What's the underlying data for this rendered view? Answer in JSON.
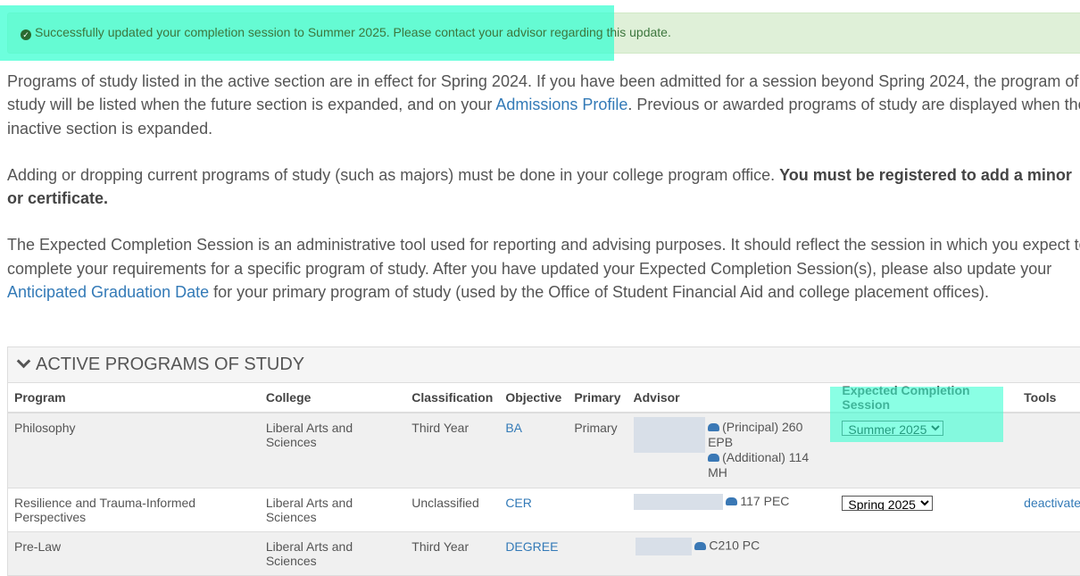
{
  "alert": {
    "icon": "check-circle-icon",
    "message": "Successfully updated your completion session to Summer 2025. Please contact your advisor regarding this update."
  },
  "intro": {
    "p1_a": "Programs of study listed in the active section are in effect for Spring 2024. If you have been admitted for a session beyond Spring 2024, the program of study will be listed when the future section is expanded, and on your ",
    "p1_link": "Admissions Profile",
    "p1_b": ". Previous or awarded programs of study are displayed when the inactive section is expanded.",
    "p2_a": "Adding or dropping current programs of study (such as majors) must be done in your college program office. ",
    "p2_bold": "You must be registered to add a minor or certificate.",
    "p3_a": "The Expected Completion Session is an administrative tool used for reporting and advising purposes. It should reflect the session in which you expect to complete your requirements for a specific program of study. After you have updated your Expected Completion Session(s), please also update your ",
    "p3_link": "Anticipated Graduation Date",
    "p3_b": " for your primary program of study (used by the Office of Student Financial Aid and college placement offices)."
  },
  "panel": {
    "title": "ACTIVE PROGRAMS OF STUDY",
    "columns": [
      "Program",
      "College",
      "Classification",
      "Objective",
      "Primary",
      "Advisor",
      "Expected Completion Session",
      "Tools"
    ],
    "rows": [
      {
        "program": "Philosophy",
        "college": "Liberal Arts and Sciences",
        "classification": "Third Year",
        "objective": "BA",
        "primary": "Primary",
        "advisor_locations": [
          "(Principal) 260 EPB",
          "(Additional) 114 MH"
        ],
        "session": "Summer 2025",
        "tools": ""
      },
      {
        "program": "Resilience and Trauma-Informed Perspectives",
        "college": "Liberal Arts and Sciences",
        "classification": "Unclassified",
        "objective": "CER",
        "primary": "",
        "advisor_locations": [
          "117 PEC"
        ],
        "session": "Spring 2025",
        "tools": "deactivate"
      },
      {
        "program": "Pre-Law",
        "college": "Liberal Arts and Sciences",
        "classification": "Third Year",
        "objective": "DEGREE",
        "primary": "",
        "advisor_locations": [
          "C210 PC"
        ],
        "session": "",
        "tools": ""
      }
    ]
  }
}
